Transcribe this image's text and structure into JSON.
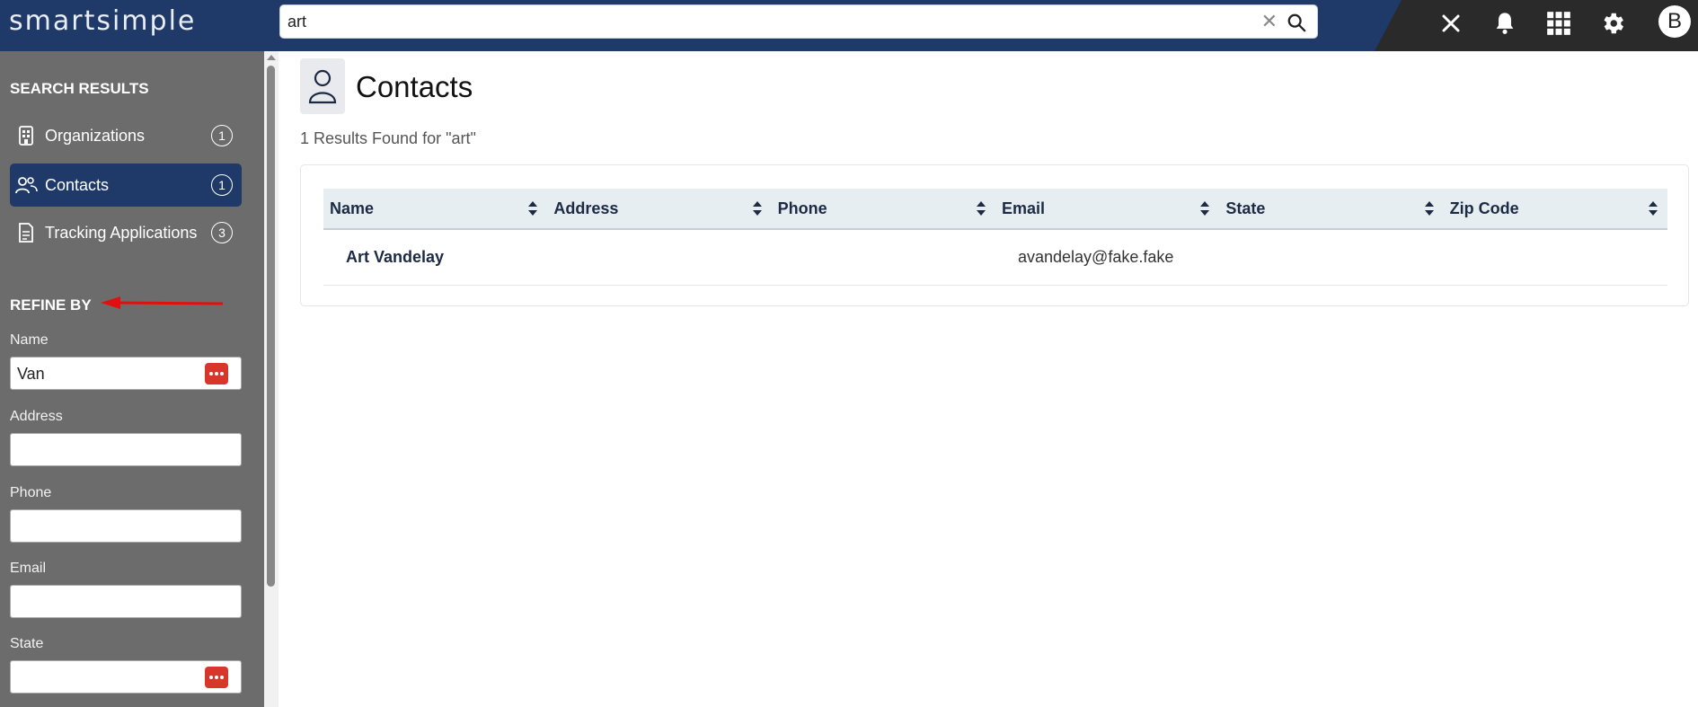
{
  "header": {
    "logo": "smartsimple",
    "search": {
      "value": "art",
      "clear_icon": "close-icon",
      "go_icon": "search-icon"
    },
    "icons": [
      "close-icon",
      "bell-icon",
      "apps-grid-icon",
      "gear-icon"
    ],
    "avatar_initial": "B"
  },
  "sidebar": {
    "search_results_heading": "SEARCH RESULTS",
    "items": [
      {
        "label": "Organizations",
        "count": "1",
        "icon": "organization-icon",
        "active": false
      },
      {
        "label": "Contacts",
        "count": "1",
        "icon": "contacts-icon",
        "active": true
      },
      {
        "label": "Tracking Applications",
        "count": "3",
        "icon": "document-icon",
        "active": false
      }
    ],
    "refine_heading": "REFINE BY",
    "fields": [
      {
        "label": "Name",
        "value": "Van",
        "has_lookup": true
      },
      {
        "label": "Address",
        "value": "",
        "has_lookup": false
      },
      {
        "label": "Phone",
        "value": "",
        "has_lookup": false
      },
      {
        "label": "Email",
        "value": "",
        "has_lookup": false
      },
      {
        "label": "State",
        "value": "",
        "has_lookup": true
      }
    ]
  },
  "main": {
    "title": "Contacts",
    "results_text": "1 Results Found for \"art\"",
    "table": {
      "columns": [
        "Name",
        "Address",
        "Phone",
        "Email",
        "State",
        "Zip Code"
      ],
      "rows": [
        {
          "name": "Art Vandelay",
          "address": "",
          "phone": "",
          "email": "avandelay@fake.fake",
          "state": "",
          "zip": ""
        }
      ]
    }
  },
  "colors": {
    "header_bg": "#1f3a68",
    "sidebar_bg": "#6c6c6c",
    "active_item": "#1f3a68",
    "lookup_button": "#d9362b",
    "annotation_arrow": "#e01010"
  }
}
